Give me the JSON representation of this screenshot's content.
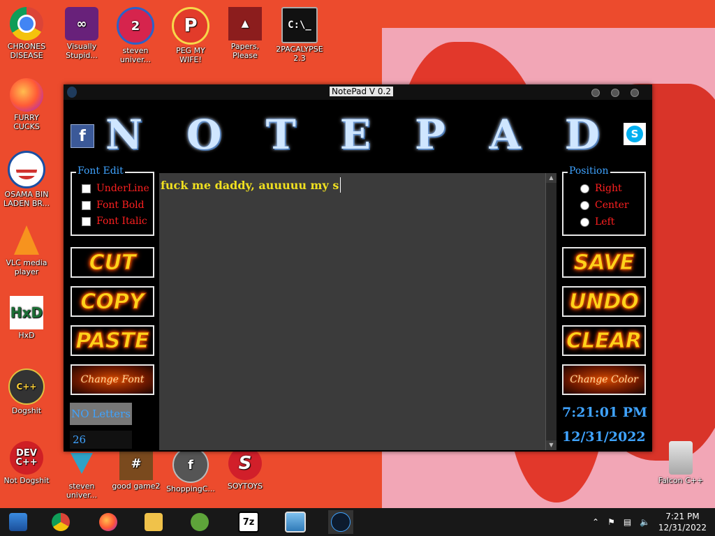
{
  "window": {
    "title": "NotePad V 0.2",
    "logo_text": "NOTEPAD",
    "social": {
      "facebook": "f",
      "skype": "S"
    },
    "font_edit": {
      "legend": "Font Edit",
      "options": [
        "UnderLine",
        "Font Bold",
        "Font Italic"
      ]
    },
    "position": {
      "legend": "Position",
      "options": [
        "Right",
        "Center",
        "Left"
      ]
    },
    "buttons": {
      "cut": "CUT",
      "copy": "COPY",
      "paste": "PASTE",
      "change_font": "Change Font",
      "save": "SAVE",
      "undo": "UNDO",
      "clear": "CLEAR",
      "change_color": "Change Color"
    },
    "editor_text": "fuck me daddy, auuuuu my s",
    "letters_label": "NO Letters",
    "letters_count": "26",
    "time": "7:21:01 PM",
    "date": "12/31/2022"
  },
  "desktop_icons": [
    {
      "label": "CHRONES DISEASE",
      "icon": "chrome-icon"
    },
    {
      "label": "Visually Stupid...",
      "icon": "visual-studio-icon"
    },
    {
      "label": "steven univer...",
      "icon": "steven-universe-icon"
    },
    {
      "label": "PEG MY WIFE!",
      "icon": "peggle-icon"
    },
    {
      "label": "Papers, Please",
      "icon": "papers-please-icon"
    },
    {
      "label": "2PACALYPSE 2.3",
      "icon": "terminal-icon"
    },
    {
      "label": "FURRY CUCKS",
      "icon": "firefox-icon"
    },
    {
      "label": "OSAMA BIN LADEN BR...",
      "icon": "obama-logo-icon"
    },
    {
      "label": "VLC media player",
      "icon": "vlc-icon"
    },
    {
      "label": "HxD",
      "icon": "hxd-icon"
    },
    {
      "label": "Dogshit",
      "icon": "codeblocks-icon"
    },
    {
      "label": "Not Dogshit",
      "icon": "devcpp-icon"
    },
    {
      "label": "steven univer...",
      "icon": "gem-icon"
    },
    {
      "label": "good game2",
      "icon": "game-icon"
    },
    {
      "label": "ShoppingC...",
      "icon": "flash-icon"
    },
    {
      "label": "SOYTOYS",
      "icon": "soytoys-icon"
    },
    {
      "label": "Falcon C++",
      "icon": "recycle-bin-icon"
    }
  ],
  "tray": {
    "time": "7:21 PM",
    "date": "12/31/2022"
  }
}
